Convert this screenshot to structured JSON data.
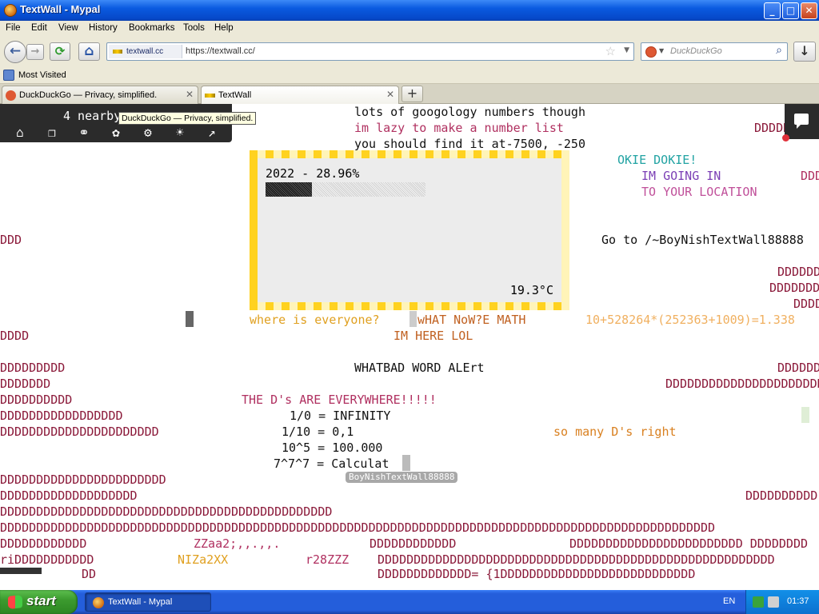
{
  "window": {
    "title": "TextWall - Mypal",
    "min": "_",
    "max": "□",
    "close": "✕"
  },
  "menu": [
    "File",
    "Edit",
    "View",
    "History",
    "Bookmarks",
    "Tools",
    "Help"
  ],
  "nav": {
    "back": "←",
    "forward": "→",
    "reload": "⟳",
    "home": "⌂",
    "download": "↓",
    "site_label": "textwall.cc",
    "url": "https://textwall.cc/",
    "search_placeholder": "DuckDuckGo"
  },
  "bookmarks": {
    "most_visited": "Most Visited"
  },
  "tabs": [
    {
      "label": "DuckDuckGo — Privacy, simplified.",
      "close": "✕"
    },
    {
      "label": "TextWall",
      "close": "✕"
    }
  ],
  "newtab": "+",
  "tooltip": "DuckDuckGo — Privacy, simplified.",
  "panel": {
    "nearby": "4 nearby"
  },
  "weather": {
    "year_line": "2022 - 28.96%",
    "progress": 0.2896,
    "temp": "19.3°C"
  },
  "wall": {
    "l1": "lots of googology numbers though",
    "l2": "im lazy to make a number list",
    "l3": "you should find it at-7500, -250",
    "d_top_right": "DDDDDDDDD",
    "okie": "OKIE DOKIE!",
    "going_in": "IM GOING IN",
    "ddd_r2": "DDD",
    "to_your": "TO YOUR LOCATION",
    "ddd_left1": "DDD",
    "goto": "Go to /~BoyNishTextWall88888",
    "r_d1": "DDDDDD",
    "r_d2": "DDDDDDD",
    "r_d3": "DDDD",
    "where": "where is everyone?",
    "what_now": "wHAT NoW?E MATH",
    "formula": "10+528264*(252363+1009)=1.338",
    "ddd_left2": "DDDD",
    "here": "IM HERE LOL",
    "d_l3": "DDDDDDDDD",
    "bad_word": "WHATBAD WORD ALErt",
    "d_r4": "DDDDDD",
    "d_l4": "DDDDDDD",
    "d_r5": "DDDDDDDDDDDDDDDDDDDDDDD",
    "d_l5": "DDDDDDDDDD",
    "everywhere": "THE D's ARE EVERYWHERE!!!!!",
    "d_l6": "DDDDDDDDDDDDDDDDD",
    "div0": "1/0 = INFINITY",
    "d_l7": "DDDDDDDDDDDDDDDDDDDDDD",
    "div10": "1/10 = 0,1",
    "so_many": "so many D's right",
    "pow": "10^5 = 100.000",
    "tet": "7^7^7 = Calculat",
    "d_l8": "DDDDDDDDDDDDDDDDDDDDDDD",
    "d_l9": "DDDDDDDDDDDDDDDDDDD",
    "d_r9": "DDDDDDDDDD",
    "d_l10": "DDDDDDDDDDDDDDDDDDDDDDDDDDDDDDDDDDDDDDDDDDDDDD",
    "d_l11": "DDDDDDDDDDDDDDDDDDDDDDDDDDDDDDDDDDDDDDDDDDDDDDDDDDDDDDDDDDDDDDDDDDDDDDDDDDDDDDDDDDDDDDDDDDDDDDDDDDD",
    "d_l12a": "DDDDDDDDDDDD",
    "zz1": "ZZaa2;,,.,,.",
    "d_l12b": "DDDDDDDDDDDD",
    "d_l12c": "DDDDDDDDDDDDDDDDDDDDDDDD DDDDDDDD",
    "ri": "riDDDDDDDDDDD",
    "ni": "NIZa2XX",
    "r28": "r28ZZZ",
    "d_l13": "DDDDDDDDDDDDDDDDDDDDDDDDDDDDDDDDDDDDDDDDDDDDDDDDDDDDDDD",
    "bottom_dd": "DD",
    "bottom_long": "DDDDDDDDDDDDD= {1DDDDDDDDDDDDDDDDDDDDDDDDDDD",
    "namechip": "BoyNishTextWall88888"
  },
  "taskbar": {
    "start": "start",
    "item": "TextWall - Mypal",
    "lang": "EN",
    "clock": "01:37"
  },
  "colors": {
    "xp_blue": "#245edb",
    "start_green": "#3c9b2f",
    "weather_border": "#ffd21f"
  }
}
